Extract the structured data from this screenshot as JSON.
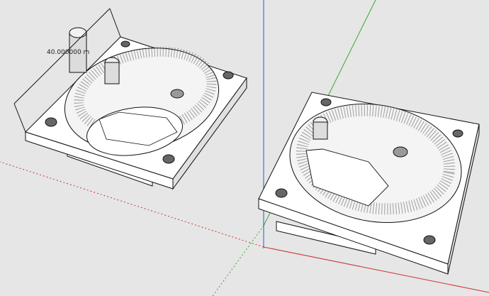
{
  "viewport": {
    "background": "#e6e6e6"
  },
  "axes": {
    "red": "#cc3333",
    "green": "#33aa33",
    "blue": "#3355cc"
  },
  "dimension": {
    "label": "40.000000 m"
  },
  "models": {
    "mesh_color": "#ffffff",
    "edge_color": "#111111",
    "hatch_color": "#333333",
    "shade_color": "#d9d9d9"
  }
}
